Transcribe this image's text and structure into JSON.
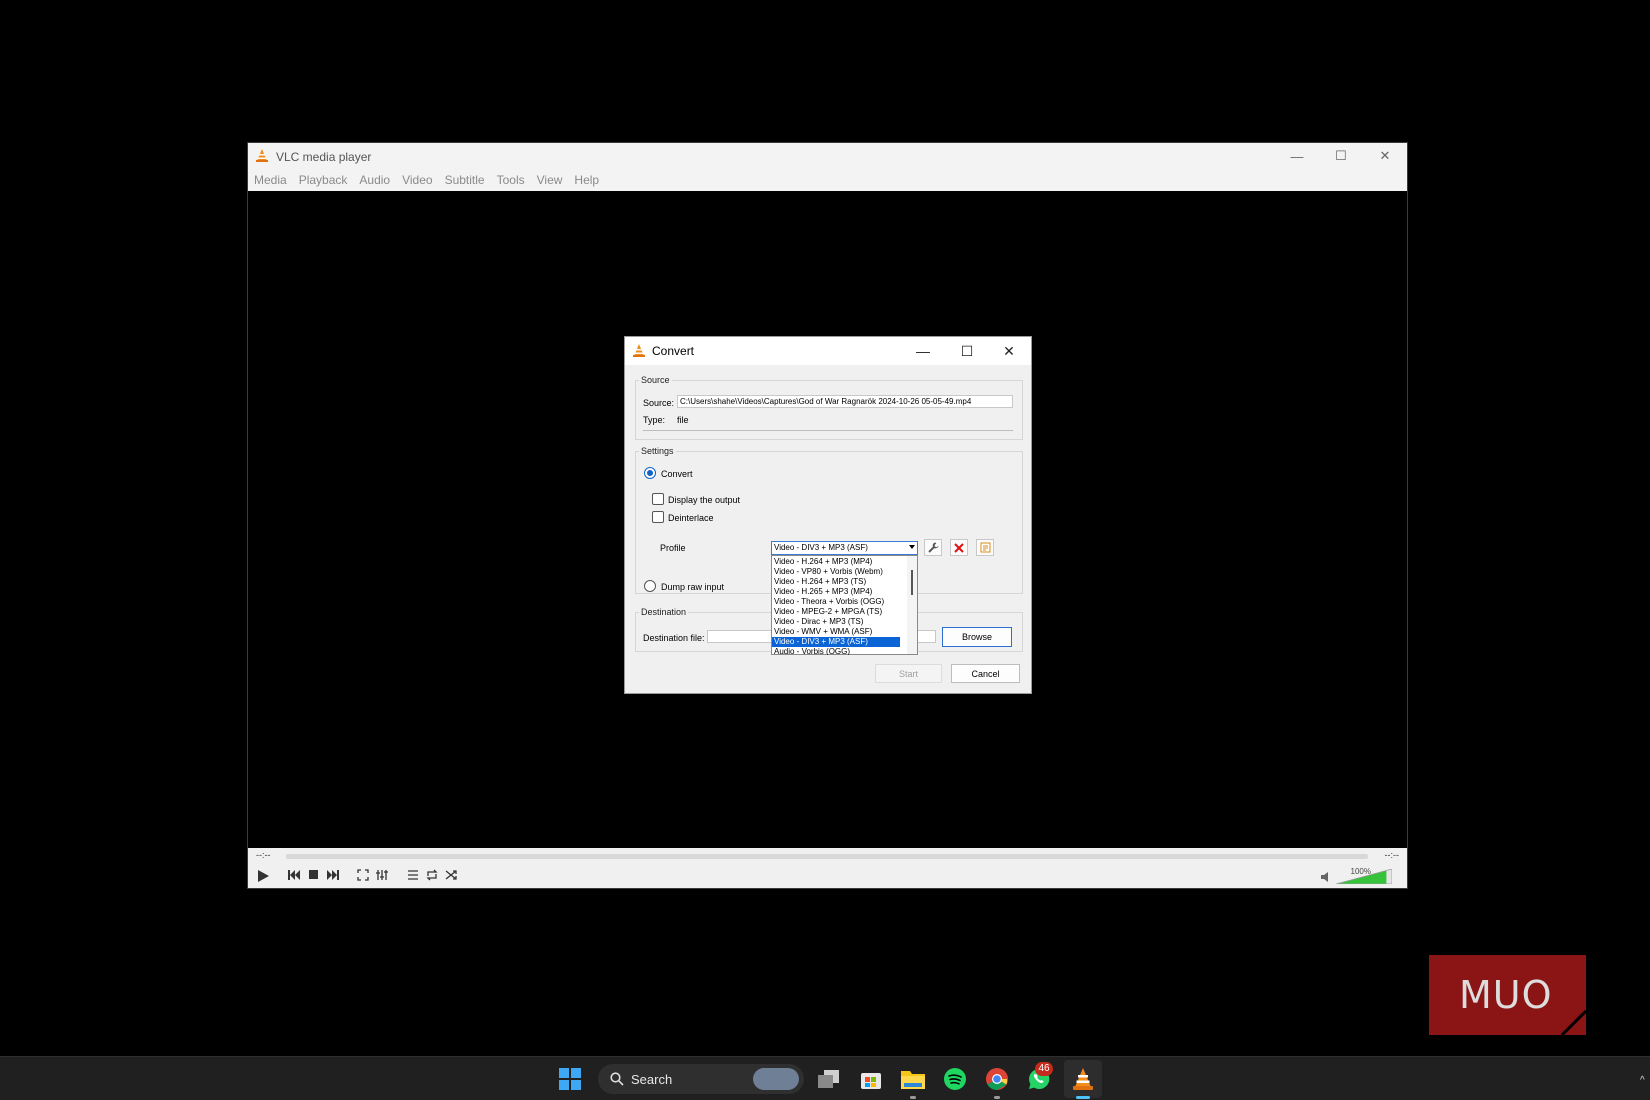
{
  "vlc": {
    "title": "VLC media player",
    "menu": [
      "Media",
      "Playback",
      "Audio",
      "Video",
      "Subtitle",
      "Tools",
      "View",
      "Help"
    ],
    "controls": {
      "time_left": "--:--",
      "time_right": "--:--",
      "volume": "100%",
      "volume_level": 1.0
    }
  },
  "dialog": {
    "title": "Convert",
    "source": {
      "group_label": "Source",
      "source_label": "Source:",
      "source_value": "C:\\Users\\shahe\\Videos\\Captures\\God of War Ragnarök 2024-10-26 05-05-49.mp4",
      "type_label": "Type:",
      "type_value": "file"
    },
    "settings": {
      "group_label": "Settings",
      "convert_label": "Convert",
      "display_output_label": "Display the output",
      "deinterlace_label": "Deinterlace",
      "profile_label": "Profile",
      "profile_selected": "Video - DIV3 + MP3 (ASF)",
      "dump_raw_label": "Dump raw input",
      "profile_options": [
        "Video - H.264 + MP3 (MP4)",
        "Video - VP80 + Vorbis (Webm)",
        "Video - H.264 + MP3 (TS)",
        "Video - H.265 + MP3 (MP4)",
        "Video - Theora + Vorbis (OGG)",
        "Video - MPEG-2 + MPGA (TS)",
        "Video - Dirac + MP3 (TS)",
        "Video - WMV + WMA (ASF)",
        "Video - DIV3 + MP3 (ASF)",
        "Audio - Vorbis (OGG)"
      ],
      "selected_index": 8
    },
    "destination": {
      "group_label": "Destination",
      "file_label": "Destination file:",
      "file_value": "",
      "browse_label": "Browse"
    },
    "start_label": "Start",
    "cancel_label": "Cancel"
  },
  "watermark": "MUO",
  "taskbar": {
    "search_label": "Search",
    "whatsapp_badge": "46"
  }
}
